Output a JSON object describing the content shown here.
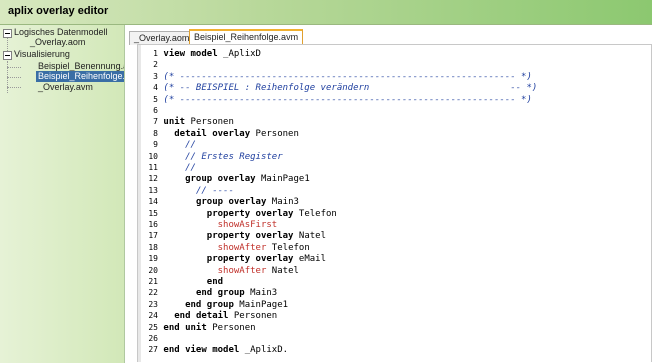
{
  "app": {
    "title": "aplix overlay editor"
  },
  "tree": {
    "items": [
      {
        "label": "Logisches Datenmodell",
        "level": 0,
        "expandable": true,
        "selected": false
      },
      {
        "label": "_Overlay.aom",
        "level": 1,
        "expandable": false,
        "selected": false
      },
      {
        "label": "Visualisierung",
        "level": 0,
        "expandable": true,
        "selected": false
      },
      {
        "label": "Beispiel_Benennung.av",
        "level": 1,
        "expandable": false,
        "selected": false
      },
      {
        "label": "Beispiel_Reihenfolge.a",
        "level": 1,
        "expandable": false,
        "selected": true
      },
      {
        "label": "_Overlay.avm",
        "level": 1,
        "expandable": false,
        "selected": false
      }
    ]
  },
  "tabs": [
    {
      "label": "_Overlay.aom",
      "active": false
    },
    {
      "label": "Beispiel_Reihenfolge.avm",
      "active": true
    }
  ],
  "colors": {
    "keyword": "#000000",
    "comment": "#1f3f9f",
    "property_value": "#c0302a"
  },
  "code": {
    "lines": [
      {
        "n": "1",
        "indent": "",
        "tokens": [
          {
            "t": "view model",
            "c": "kw"
          },
          {
            "t": " _AplixD",
            "c": "tx"
          }
        ]
      },
      {
        "n": "2",
        "indent": "",
        "tokens": []
      },
      {
        "n": "3",
        "indent": "",
        "tokens": [
          {
            "t": "(* -------------------------------------------------------------- *)",
            "c": "cm"
          }
        ]
      },
      {
        "n": "4",
        "indent": "",
        "tokens": [
          {
            "t": "(* -- BEISPIEL : Reihenfolge verändern                          -- *)",
            "c": "cm"
          }
        ]
      },
      {
        "n": "5",
        "indent": "",
        "tokens": [
          {
            "t": "(* -------------------------------------------------------------- *)",
            "c": "cm"
          }
        ]
      },
      {
        "n": "6",
        "indent": "",
        "tokens": []
      },
      {
        "n": "7",
        "indent": "",
        "tokens": [
          {
            "t": "unit",
            "c": "kw"
          },
          {
            "t": " Personen",
            "c": "tx"
          }
        ]
      },
      {
        "n": "8",
        "indent": "  ",
        "tokens": [
          {
            "t": "detail overlay",
            "c": "kw"
          },
          {
            "t": " Personen",
            "c": "tx"
          }
        ]
      },
      {
        "n": "9",
        "indent": "    ",
        "tokens": [
          {
            "t": "//",
            "c": "cm"
          }
        ]
      },
      {
        "n": "10",
        "indent": "    ",
        "tokens": [
          {
            "t": "// Erstes Register",
            "c": "cm"
          }
        ]
      },
      {
        "n": "11",
        "indent": "    ",
        "tokens": [
          {
            "t": "//",
            "c": "cm"
          }
        ]
      },
      {
        "n": "12",
        "indent": "    ",
        "tokens": [
          {
            "t": "group overlay",
            "c": "kw"
          },
          {
            "t": " MainPage1",
            "c": "tx"
          }
        ]
      },
      {
        "n": "13",
        "indent": "      ",
        "tokens": [
          {
            "t": "// ----",
            "c": "cm"
          }
        ]
      },
      {
        "n": "14",
        "indent": "      ",
        "tokens": [
          {
            "t": "group overlay",
            "c": "kw"
          },
          {
            "t": " Main3",
            "c": "tx"
          }
        ]
      },
      {
        "n": "15",
        "indent": "        ",
        "tokens": [
          {
            "t": "property overlay",
            "c": "kw"
          },
          {
            "t": " Telefon",
            "c": "tx"
          }
        ]
      },
      {
        "n": "16",
        "indent": "          ",
        "tokens": [
          {
            "t": "showAsFirst",
            "c": "rd"
          }
        ]
      },
      {
        "n": "17",
        "indent": "        ",
        "tokens": [
          {
            "t": "property overlay",
            "c": "kw"
          },
          {
            "t": " Natel",
            "c": "tx"
          }
        ]
      },
      {
        "n": "18",
        "indent": "          ",
        "tokens": [
          {
            "t": "showAfter",
            "c": "rd"
          },
          {
            "t": " Telefon",
            "c": "tx"
          }
        ]
      },
      {
        "n": "19",
        "indent": "        ",
        "tokens": [
          {
            "t": "property overlay",
            "c": "kw"
          },
          {
            "t": " eMail",
            "c": "tx"
          }
        ]
      },
      {
        "n": "20",
        "indent": "          ",
        "tokens": [
          {
            "t": "showAfter",
            "c": "rd"
          },
          {
            "t": " Natel",
            "c": "tx"
          }
        ]
      },
      {
        "n": "21",
        "indent": "        ",
        "tokens": [
          {
            "t": "end",
            "c": "kw"
          }
        ]
      },
      {
        "n": "22",
        "indent": "      ",
        "tokens": [
          {
            "t": "end group",
            "c": "kw"
          },
          {
            "t": " Main3",
            "c": "tx"
          }
        ]
      },
      {
        "n": "23",
        "indent": "    ",
        "tokens": [
          {
            "t": "end group",
            "c": "kw"
          },
          {
            "t": " MainPage1",
            "c": "tx"
          }
        ]
      },
      {
        "n": "24",
        "indent": "  ",
        "tokens": [
          {
            "t": "end detail",
            "c": "kw"
          },
          {
            "t": " Personen",
            "c": "tx"
          }
        ]
      },
      {
        "n": "25",
        "indent": "",
        "tokens": [
          {
            "t": "end unit",
            "c": "kw"
          },
          {
            "t": " Personen",
            "c": "tx"
          }
        ]
      },
      {
        "n": "26",
        "indent": "",
        "tokens": []
      },
      {
        "n": "27",
        "indent": "",
        "tokens": [
          {
            "t": "end view model",
            "c": "kw"
          },
          {
            "t": " _AplixD.",
            "c": "tx"
          }
        ]
      }
    ]
  }
}
